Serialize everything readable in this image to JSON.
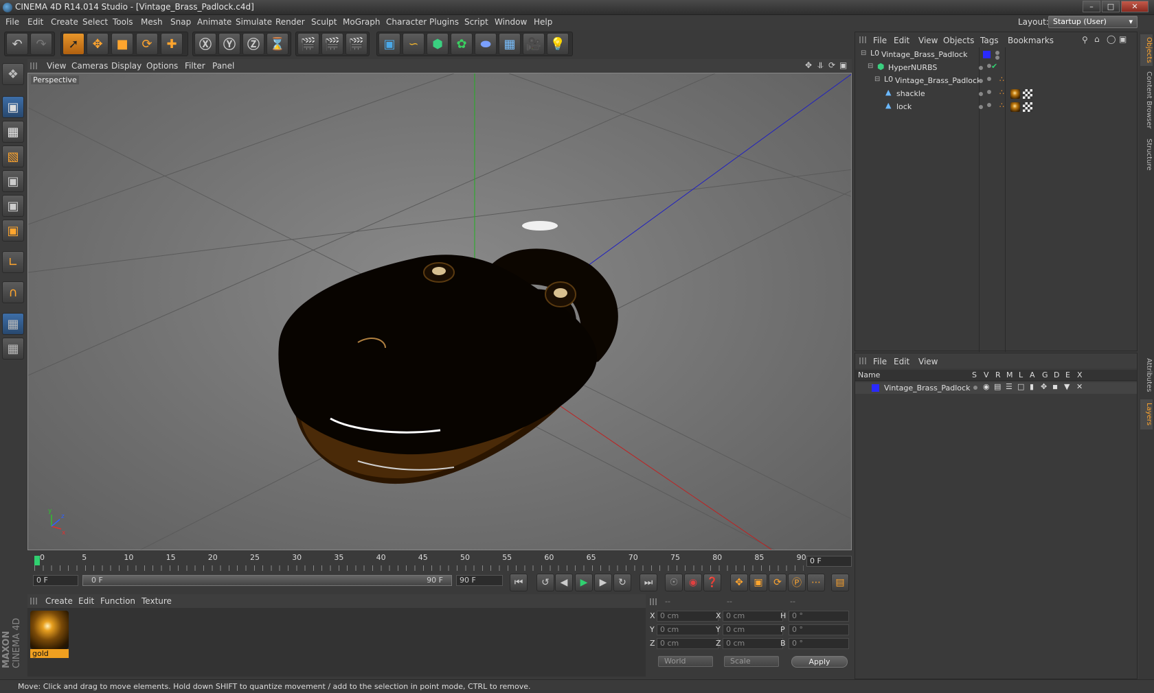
{
  "window": {
    "title": "CINEMA 4D R14.014 Studio - [Vintage_Brass_Padlock.c4d]",
    "min_label": "–",
    "max_label": "□",
    "close_label": "✕"
  },
  "menubar": {
    "items": [
      "File",
      "Edit",
      "Create",
      "Select",
      "Tools",
      "Mesh",
      "Snap",
      "Animate",
      "Simulate",
      "Render",
      "Sculpt",
      "MoGraph",
      "Character",
      "Plugins",
      "Script",
      "Window",
      "Help"
    ],
    "layout_label": "Layout:",
    "layout_value": "Startup (User)"
  },
  "toolbar": {
    "icons": [
      "undo-icon",
      "redo-icon",
      "live-selection-icon",
      "move-icon",
      "scale-icon",
      "rotate-icon",
      "add-icon",
      "x-axis-icon",
      "y-axis-icon",
      "z-axis-icon",
      "coordinate-system-icon",
      "render-view-icon",
      "render-to-picture-viewer-icon",
      "render-settings-icon",
      "cube-icon",
      "spline-pen-icon",
      "subdivision-icon",
      "cloner-icon",
      "deformer-icon",
      "floor-icon",
      "camera-icon",
      "light-icon"
    ]
  },
  "viewport": {
    "menu": [
      "View",
      "Cameras",
      "Display",
      "Options",
      "Filter",
      "Panel"
    ],
    "label": "Perspective"
  },
  "timeline": {
    "ticks": [
      "0",
      "5",
      "10",
      "15",
      "20",
      "25",
      "30",
      "35",
      "40",
      "45",
      "50",
      "55",
      "60",
      "65",
      "70",
      "75",
      "80",
      "85",
      "90"
    ],
    "current_frame": "0 F",
    "start_field": "0 F",
    "range_start": "0 F",
    "range_end": "90 F",
    "end_field": "90 F"
  },
  "materials": {
    "menu": [
      "Create",
      "Edit",
      "Function",
      "Texture"
    ],
    "items": [
      {
        "name": "gold"
      }
    ]
  },
  "coords": {
    "col_headers": [
      "--",
      "--",
      "--"
    ],
    "rows": [
      {
        "axis": "X",
        "pos": "0 cm",
        "axis2": "X",
        "size": "0 cm",
        "rot_label": "H",
        "rot": "0 °"
      },
      {
        "axis": "Y",
        "pos": "0 cm",
        "axis2": "Y",
        "size": "0 cm",
        "rot_label": "P",
        "rot": "0 °"
      },
      {
        "axis": "Z",
        "pos": "0 cm",
        "axis2": "Z",
        "size": "0 cm",
        "rot_label": "B",
        "rot": "0 °"
      }
    ],
    "mode_dropdown": "World",
    "scale_dropdown": "Scale",
    "apply_label": "Apply"
  },
  "status": {
    "text": "Move: Click and drag to move elements. Hold down SHIFT to quantize movement / add to the selection in point mode, CTRL to remove."
  },
  "object_manager": {
    "menu": [
      "File",
      "Edit",
      "View",
      "Objects",
      "Tags",
      "Bookmarks"
    ],
    "objects": [
      {
        "name": "Vintage_Brass_Padlock",
        "indent": 0,
        "type": "null"
      },
      {
        "name": "HyperNURBS",
        "indent": 1,
        "type": "hypernurbs"
      },
      {
        "name": "Vintage_Brass_Padlock",
        "indent": 2,
        "type": "null"
      },
      {
        "name": "shackle",
        "indent": 3,
        "type": "polygon"
      },
      {
        "name": "lock",
        "indent": 3,
        "type": "polygon"
      }
    ]
  },
  "layer_manager": {
    "menu": [
      "File",
      "Edit",
      "View"
    ],
    "columns": [
      "Name",
      "S",
      "V",
      "R",
      "M",
      "L",
      "A",
      "G",
      "D",
      "E",
      "X"
    ],
    "layers": [
      {
        "name": "Vintage_Brass_Padlock",
        "color": "#2a2aff"
      }
    ]
  },
  "side_tabs": [
    "Objects",
    "Content Browser",
    "Structure",
    "Attributes",
    "Layers"
  ],
  "brand": {
    "maxon": "MAXON",
    "cinema": "CINEMA 4D"
  },
  "colors": {
    "accent": "#ffa52e",
    "layer": "#2a2aff",
    "x_axis": "#c02020",
    "y_axis": "#20b020",
    "z_axis": "#2020c0"
  }
}
